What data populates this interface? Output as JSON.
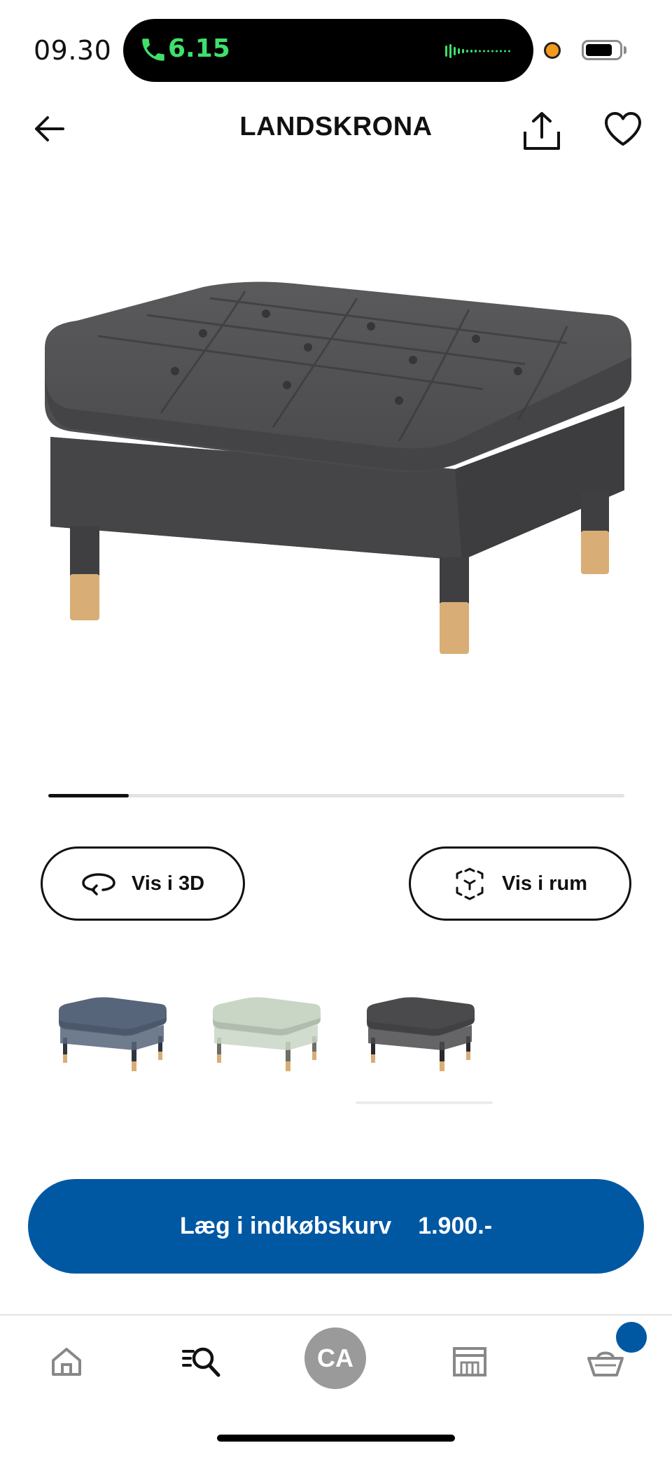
{
  "status_bar": {
    "time": "09.30",
    "call_timer": "6.15",
    "icons": [
      "phone-icon",
      "waveform-icon",
      "recording-dot-icon",
      "battery-icon"
    ]
  },
  "header": {
    "title": "LANDSKRONA",
    "icons": [
      "arrow-left-icon",
      "share-icon",
      "heart-icon"
    ]
  },
  "product": {
    "image": "grey-tufted-footstool-with-wooden-legs",
    "carousel_progress": 0.14
  },
  "actions": {
    "view_3d_label": "Vis i 3D",
    "view_room_label": "Vis i rum"
  },
  "variants": [
    {
      "color": "#56657a",
      "legs": "#2f3540"
    },
    {
      "color": "#c9d6c5",
      "legs": "#6b6f66"
    },
    {
      "color": "#4a4a4d",
      "legs": "#2a2a2c"
    }
  ],
  "cart": {
    "label": "Læg i indkøbskurv",
    "price": "1.900.-"
  },
  "bottom_nav": {
    "avatar_initials": "CA",
    "items": [
      "home-icon",
      "search-icon",
      "avatar",
      "store-icon",
      "basket-icon"
    ]
  },
  "colors": {
    "brand_blue": "#0058a3",
    "call_green": "#3ee06b",
    "dot_orange": "#f39a1e"
  }
}
